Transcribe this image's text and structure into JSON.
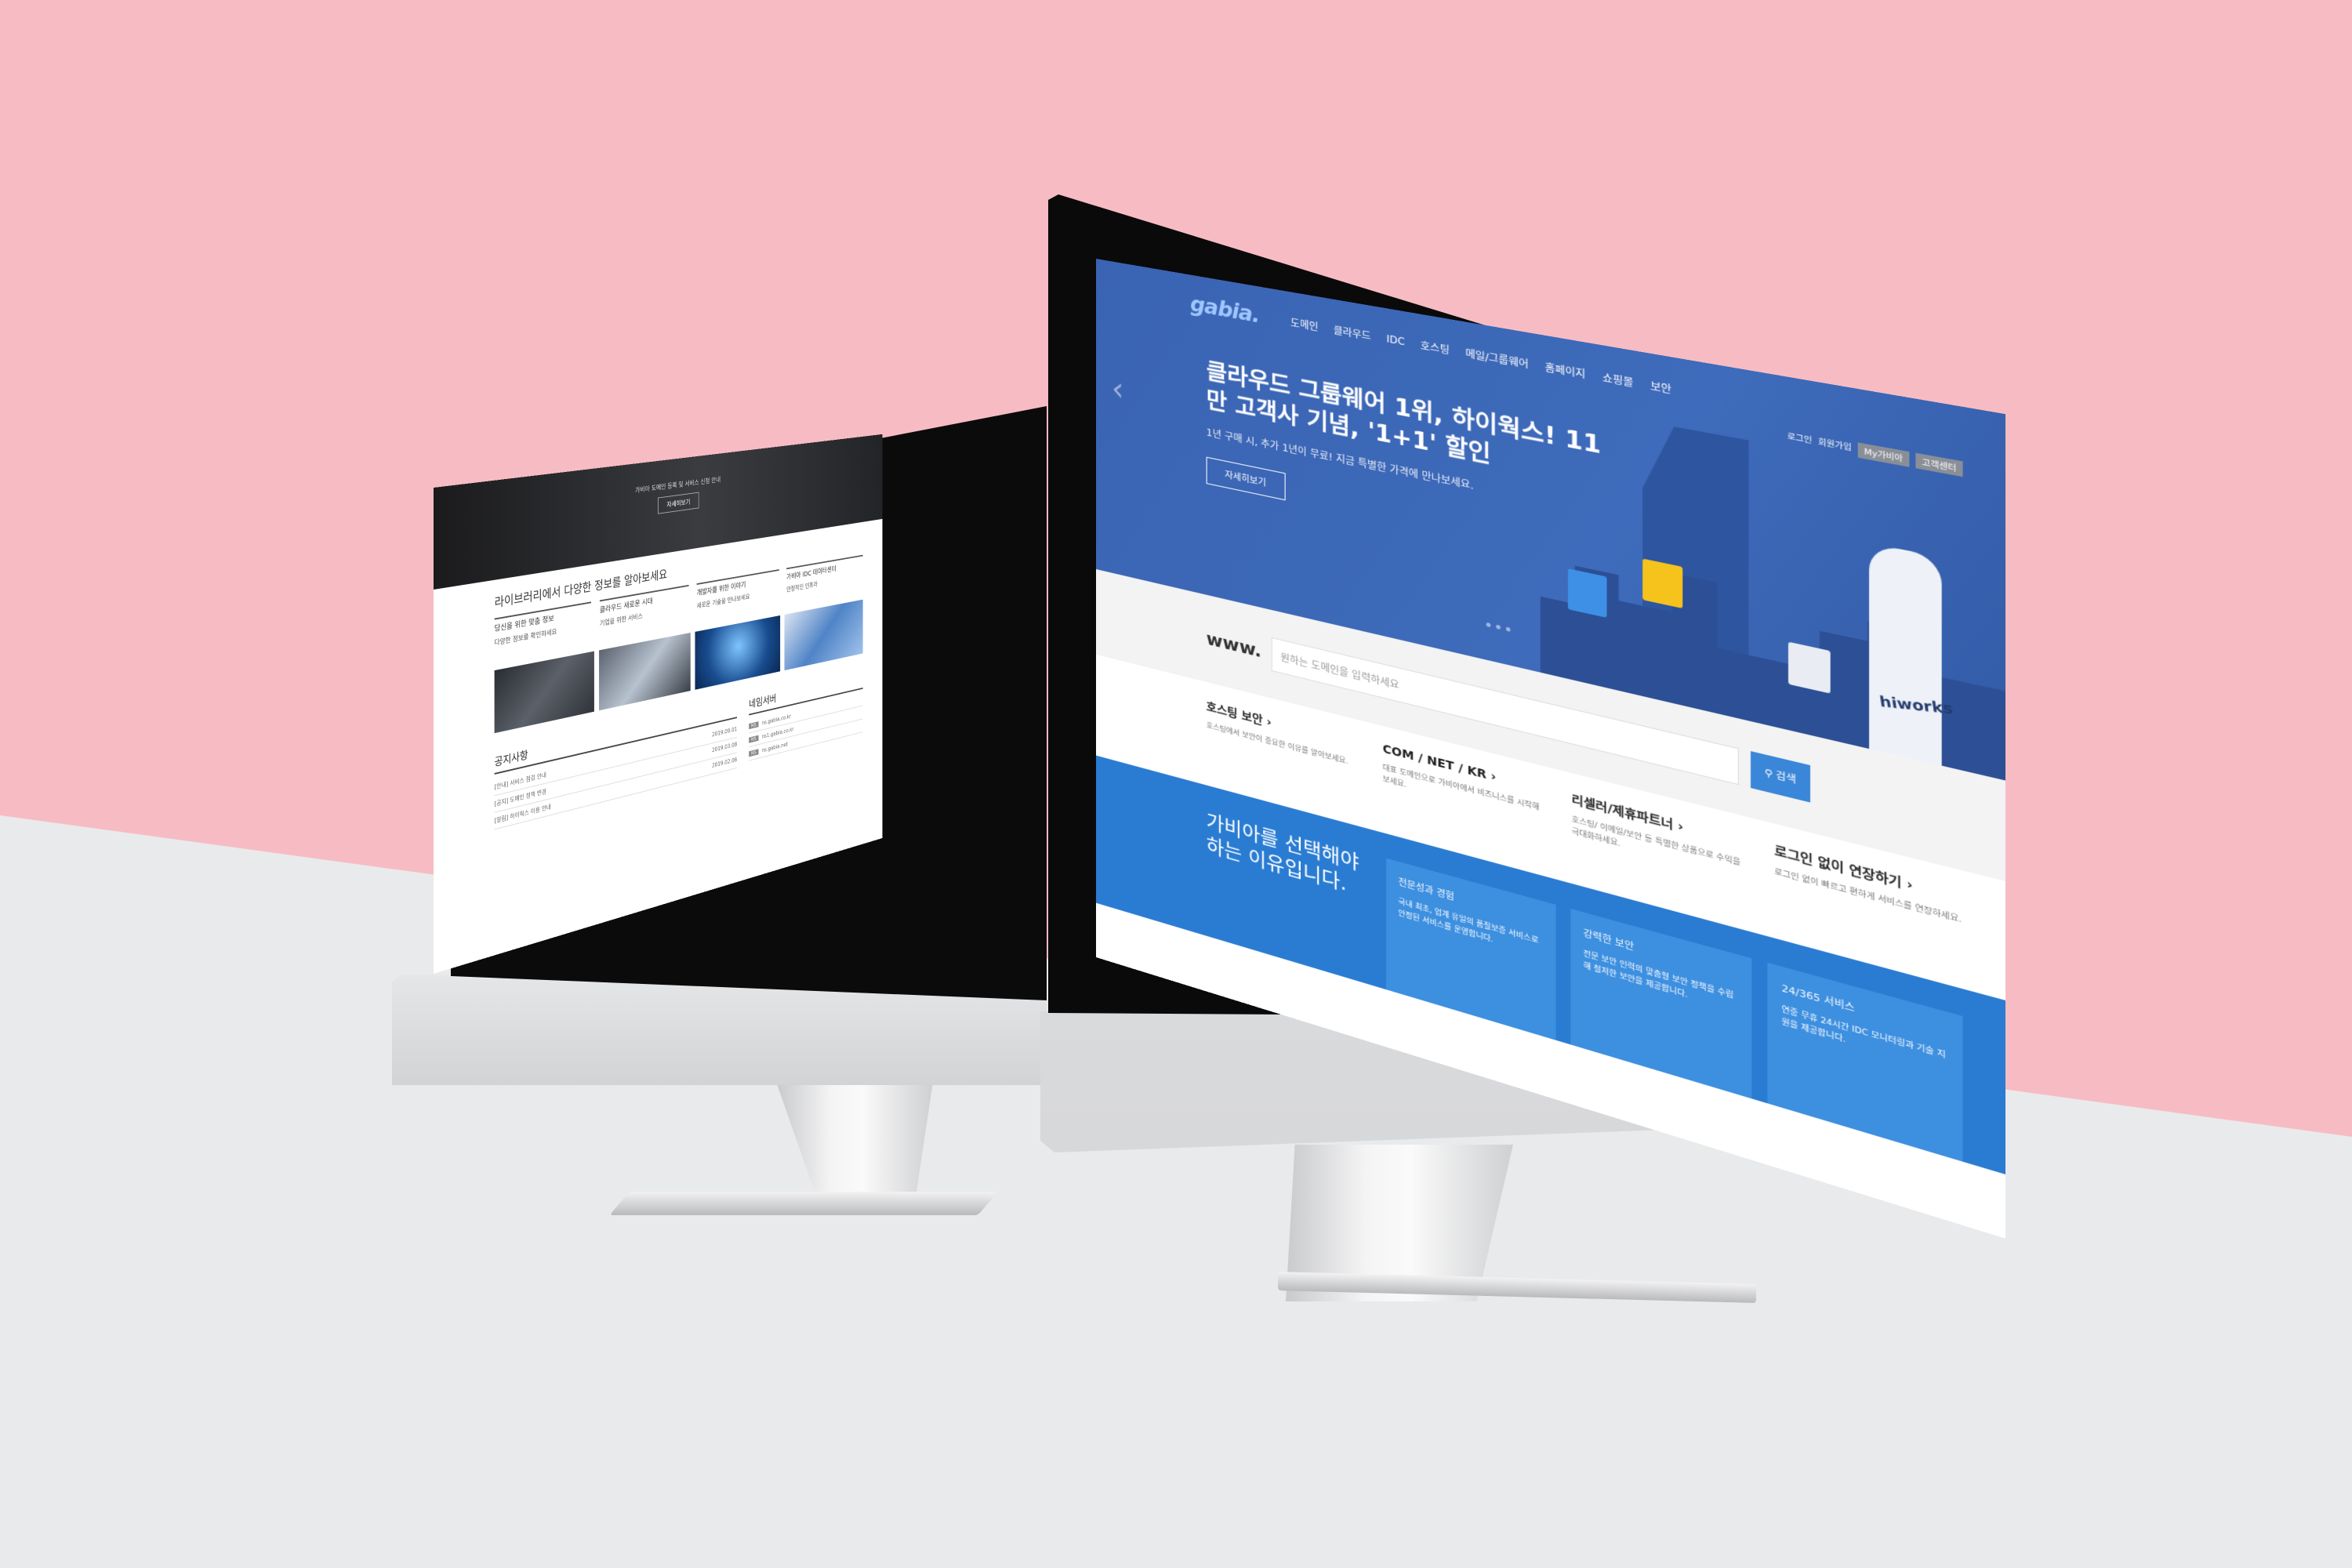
{
  "left": {
    "hero_text": "가비아 도메인 등록 및 서비스 신청 안내",
    "hero_button": "자세히보기",
    "library_title": "라이브러리에서 다양한 정보를 알아보세요",
    "library_cols": [
      {
        "title": "당신을 위한 맞춤 정보",
        "text": "다양한 정보를 확인하세요"
      },
      {
        "title": "클라우드 새로운 시대",
        "text": "기업을 위한 서비스"
      },
      {
        "title": "개발자를 위한 이야기",
        "text": "새로운 기술을 만나보세요"
      },
      {
        "title": "가비아 IDC 데이터센터",
        "text": "안정적인 인프라"
      }
    ],
    "notice_title": "공지사항",
    "notice_rows": [
      {
        "text": "[안내] 서비스 점검 안내",
        "date": "2019.09.01"
      },
      {
        "text": "[공지] 도메인 정책 변경",
        "date": "2019.03.08"
      },
      {
        "text": "[알림] 하이웍스 이용 안내",
        "date": "2019.02.06"
      }
    ],
    "ns_title": "네임서버",
    "ns_rows": [
      {
        "tag": "NS",
        "text": "ns.gabia.co.kr"
      },
      {
        "tag": "NS",
        "text": "ns1.gabia.co.kr"
      },
      {
        "tag": "NS",
        "text": "ns.gabia.net"
      }
    ]
  },
  "right": {
    "logo": "gabia.",
    "nav": [
      "도메인",
      "클라우드",
      "IDC",
      "호스팅",
      "메일/그룹웨어",
      "홈페이지",
      "쇼핑몰",
      "보안"
    ],
    "util": {
      "login": "로그인",
      "join": "회원가입",
      "chip1": "My가비아",
      "chip2": "고객센터"
    },
    "headline": "클라우드 그룹웨어 1위, 하이웍스! 11만 고객사 기념, '1+1' 할인",
    "subtext": "1년 구매 시, 추가 1년이 무료! 지금 특별한 가격에 만나보세요.",
    "detail_button": "자세히보기",
    "brand": "hiworks",
    "search_prefix": "www.",
    "search_placeholder": "원하는 도메인을 입력하세요",
    "search_button": "검색",
    "services": [
      {
        "title": "호스팅 보안 ›",
        "desc": "호스팅에서 보안이 중요한 이유를 알아보세요."
      },
      {
        "title": "COM / NET / KR ›",
        "desc": "대표 도메인으로 가비아에서 비즈니스를 시작해보세요."
      },
      {
        "title": "리셀러/제휴파트너 ›",
        "desc": "호스팅/ 이메일/보안 등 특별한 상품으로 수익을 극대화하세요."
      },
      {
        "title": "로그인 없이 연장하기 ›",
        "desc": "로그인 없이 빠르고 편하게 서비스를 연장하세요."
      }
    ],
    "why_title": "가비아를 선택해야 하는 이유입니다.",
    "why_cards": [
      {
        "title": "전문성과 경험",
        "text": "국내 최초, 업계 유일의 품질보증 서비스로 안정된 서비스를 운영합니다."
      },
      {
        "title": "강력한 보안",
        "text": "전문 보안 인력의 맞춤형 보안 정책을 수립해 철저한 보안을 제공합니다."
      },
      {
        "title": "24/365 서비스",
        "text": "연중 무휴 24시간 IDC 모니터링과 기술 지원을 제공합니다."
      }
    ]
  }
}
